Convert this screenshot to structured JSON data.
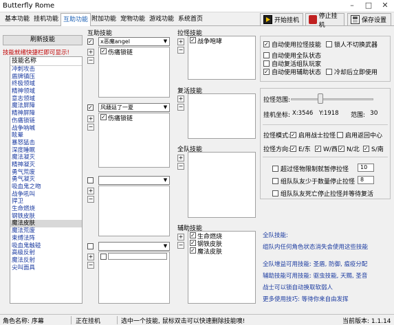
{
  "window": {
    "title": "Butterfly Rome"
  },
  "tabs": [
    {
      "label": "基本功能",
      "active": false
    },
    {
      "label": "挂机功能",
      "active": false
    },
    {
      "label": "互助功能",
      "active": true
    },
    {
      "label": "附加功能",
      "active": false
    },
    {
      "label": "宠物功能",
      "active": false
    },
    {
      "label": "游戏功能",
      "active": false
    },
    {
      "label": "系统首页",
      "active": false
    }
  ],
  "toolbar": {
    "start": "开始挂机",
    "stop": "停止挂机",
    "save": "保存设置"
  },
  "left": {
    "refresh_button": "刷新技能",
    "hint": "技能就绪快捷栏即可显示!",
    "list_header": "技能名称",
    "skills": [
      "冲刺攻击",
      "盾牌镇压",
      "终极领域",
      "精神领域",
      "意志领域",
      "魔法屏障",
      "精神屏障",
      "伤痛锁链",
      "战争呐喊",
      "眩晕",
      "暴怒猛击",
      "深度睡眠",
      "魔法凝灭",
      "精神凝灭",
      "勇气荒废",
      "勇气凝灭",
      "吸血鬼之吻",
      "战争吼叫",
      "捍卫",
      "生命燃烧",
      "钢铁皮肤",
      "魔法皮肤",
      "魔法荒废",
      "束缚法阵",
      "吸血鬼触碰",
      "高级反射",
      "魔法反射",
      "尖叫面具"
    ],
    "selected_index": 21
  },
  "mutual": {
    "title": "互助技能",
    "slots": [
      {
        "checked": true,
        "combo": "x恶魔angel",
        "items": [
          "伤痛锁链"
        ]
      },
      {
        "checked": true,
        "combo": "风薐廷了一夏",
        "items": [
          "伤痛锁链"
        ]
      },
      {
        "checked": false,
        "combo": "",
        "items": []
      },
      {
        "checked": false,
        "combo": "",
        "items": [
          ""
        ]
      }
    ]
  },
  "pull": {
    "pull_title": "拉怪技能",
    "pull_items": [
      "战争咆哮"
    ],
    "revive_title": "复活技能",
    "team_title": "全队技能",
    "assist_title": "辅助技能",
    "assist_items": [
      "生命燃烧",
      "钢铁皮肤",
      "魔法皮肤"
    ]
  },
  "options": {
    "auto_pull": "自动使用拉怪技能",
    "lock_weapon": "锁人不切换武器",
    "auto_team": "自动使用全队状态",
    "auto_revive": "自动复活组队玩家",
    "auto_assist": "自动使用辅助状态",
    "cooldown_after": "冷却后立即使用"
  },
  "pull_settings": {
    "range_label": "拉怪范围:",
    "range_value_label": "范围:",
    "range_value": "30",
    "coord_label": "挂机坐标:",
    "coord_x": "X:3546",
    "coord_y": "Y:1918",
    "mode_label": "拉怪模式:",
    "mode_warrior": "启用战士拉怪",
    "mode_return": "启用返回中心",
    "dir_label": "拉怪方向:",
    "dirs": [
      "E/东",
      "W/西",
      "N/北",
      "S/南"
    ],
    "stop1": "超过怪物限制就暂停拉怪",
    "stop1_value": "10",
    "stop2": "组队队友少于数量停止拉怪",
    "stop2_value": "8",
    "stop3": "组队队友死亡停止拉怪并等待复活"
  },
  "info": {
    "title": "全队技能:",
    "lines": [
      "组队内任何角色状态消失会使用这些技能",
      "全队增益可用技能: 圣盾, 防御, 瘟疫分配",
      "辅助技能可用技能: 驱虫技能, 天赐, 圣音",
      "战士可以锁自动换取软弱人",
      "更多使用技巧: 等待你来自由发挥"
    ]
  },
  "status": {
    "role": "角色名称: 序幕",
    "state": "正在挂机",
    "tip": "选中一个技能, 鼠标双击可以快速删除技能噢!",
    "version": "当前版本: 1.1.14"
  },
  "colors": {
    "accent_blue": "#1a3aa0",
    "hint_red": "#c00000"
  }
}
